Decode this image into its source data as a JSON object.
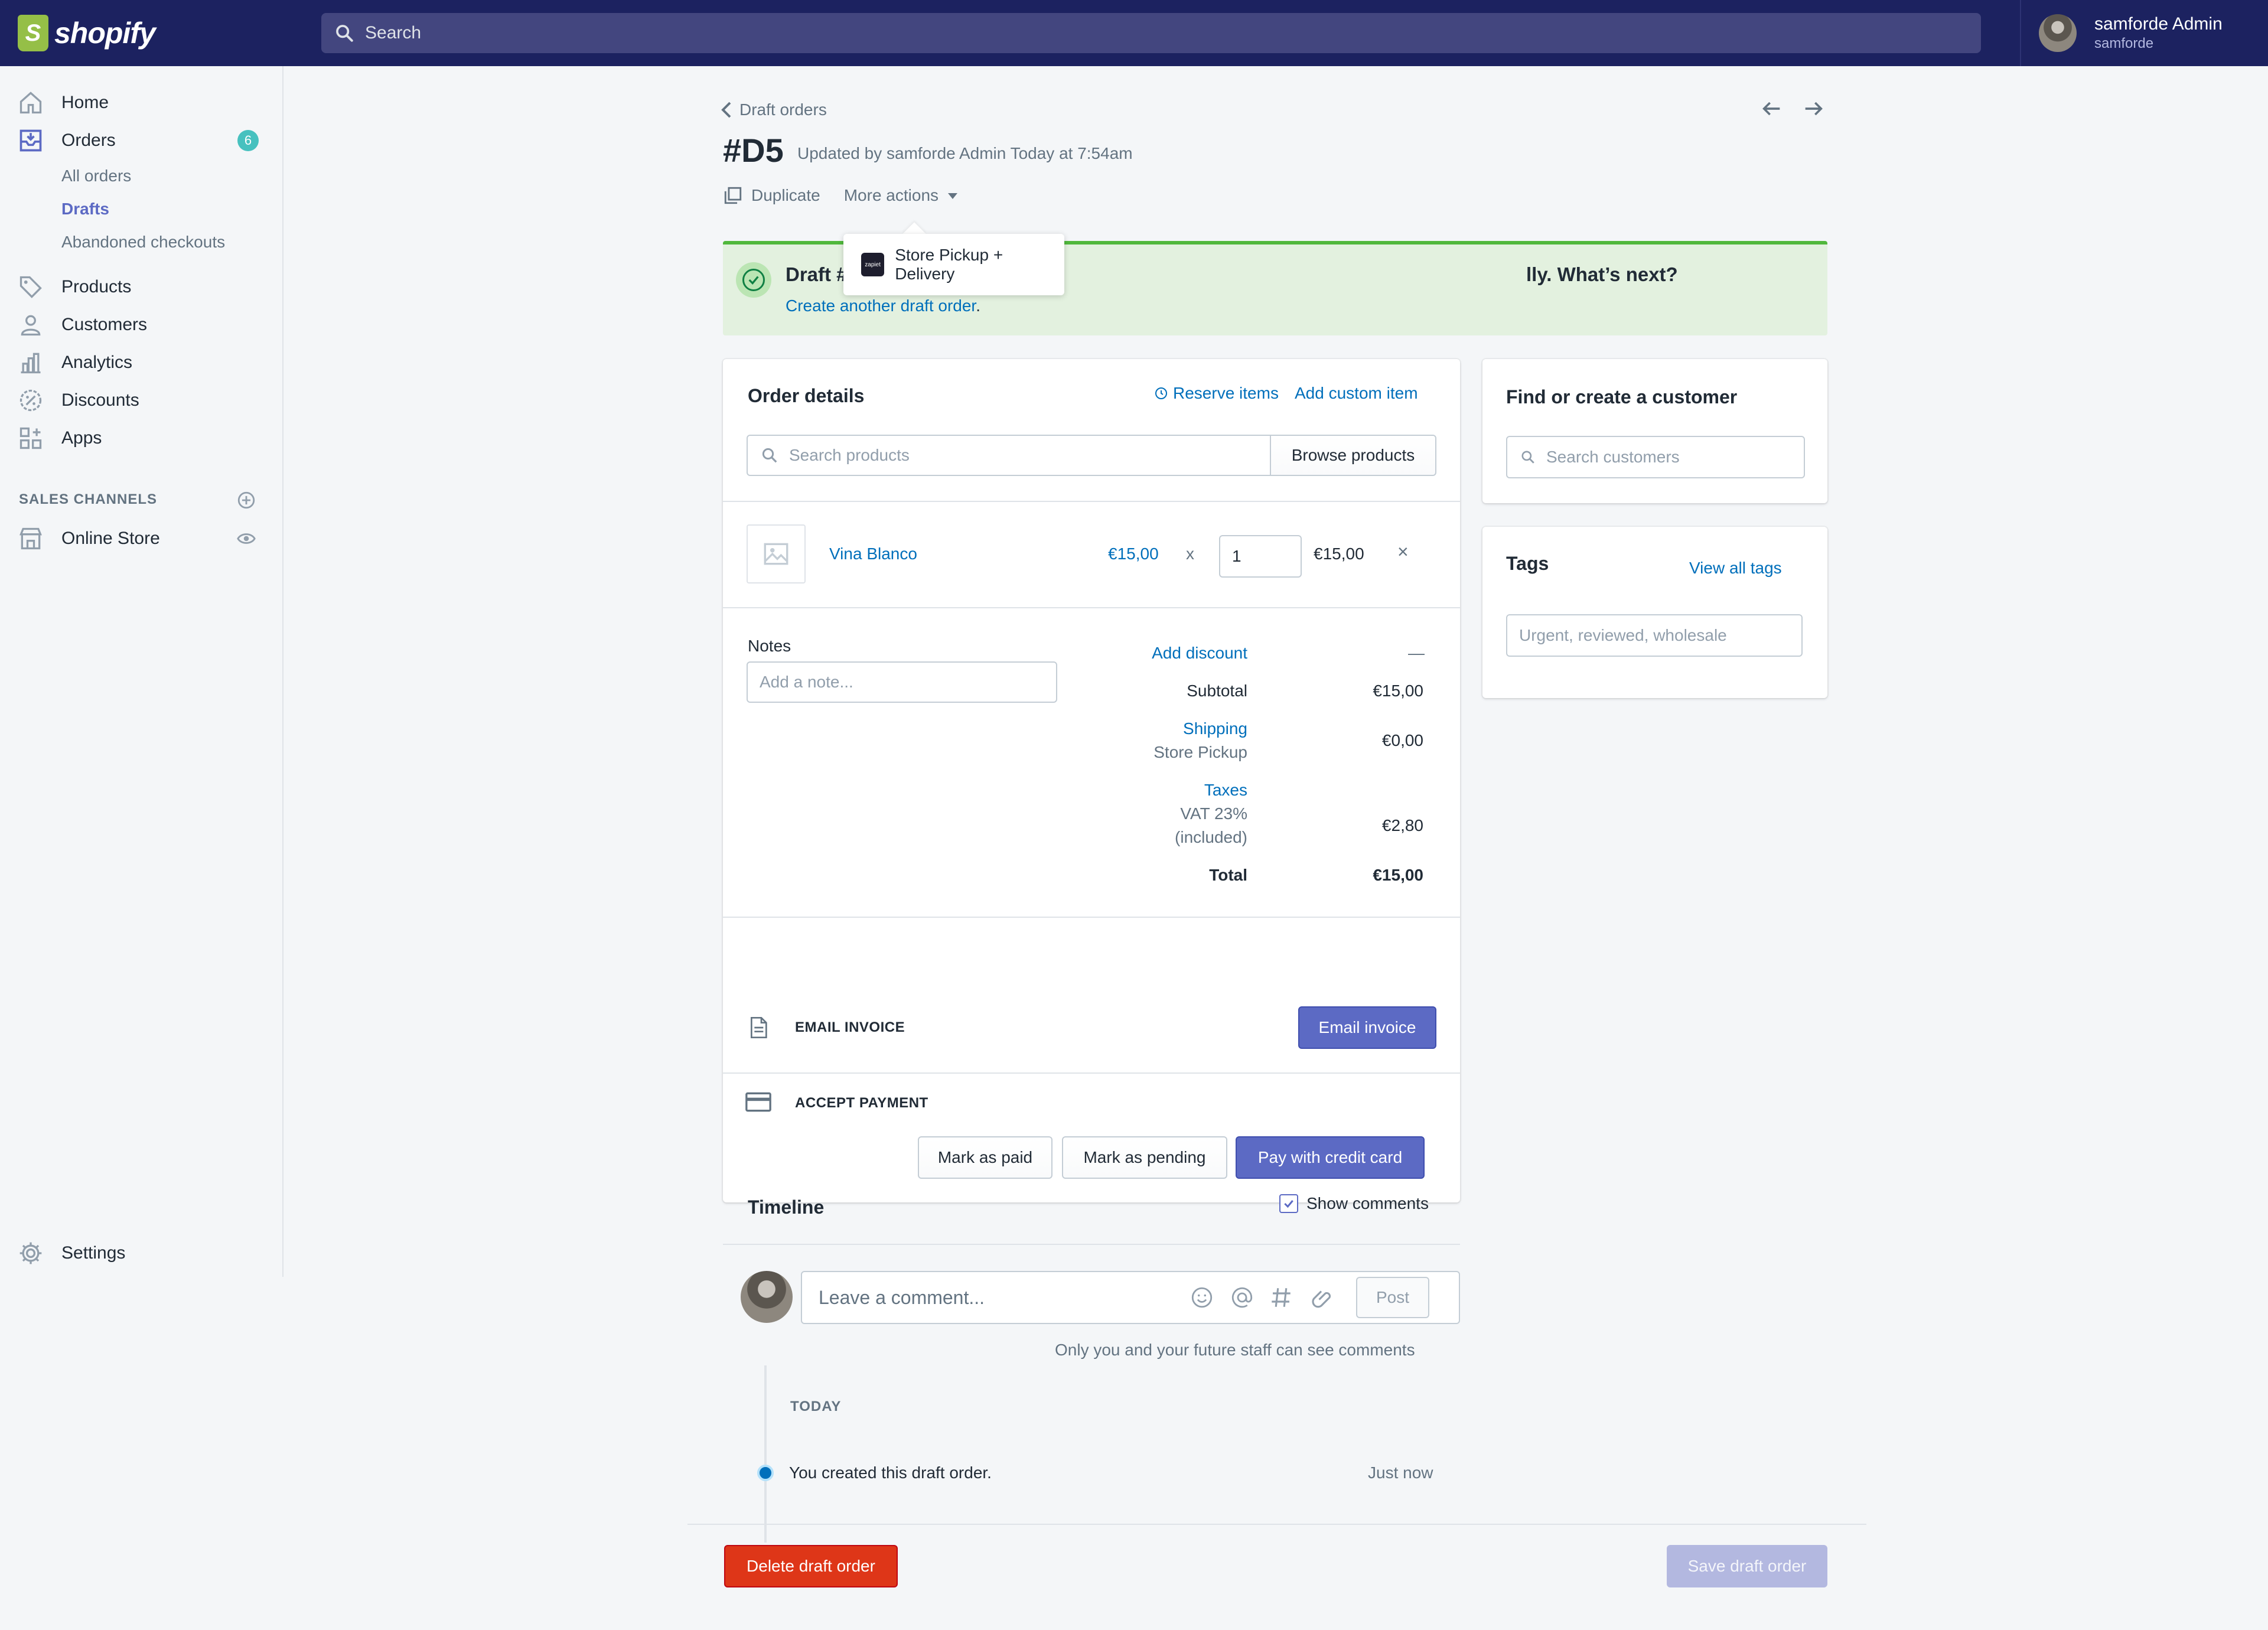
{
  "app": {
    "logo_text": "shopify",
    "logo_letter": "S"
  },
  "topbar": {
    "search_placeholder": "Search",
    "user_name": "samforde Admin",
    "user_store": "samforde"
  },
  "sidebar": {
    "items": [
      {
        "label": "Home",
        "icon": "home-icon"
      },
      {
        "label": "Orders",
        "icon": "orders-icon",
        "badge": "6"
      },
      {
        "label": "Products",
        "icon": "tag-icon"
      },
      {
        "label": "Customers",
        "icon": "person-icon"
      },
      {
        "label": "Analytics",
        "icon": "bar-chart-icon"
      },
      {
        "label": "Discounts",
        "icon": "discount-icon"
      },
      {
        "label": "Apps",
        "icon": "apps-icon"
      }
    ],
    "order_subitems": [
      "All orders",
      "Drafts",
      "Abandoned checkouts"
    ],
    "sales_channels_title": "SALES CHANNELS",
    "online_store": "Online Store",
    "settings": "Settings"
  },
  "page": {
    "back_label": "Draft orders",
    "title": "#D5",
    "subtitle": "Updated by samforde Admin Today at 7:54am",
    "duplicate": "Duplicate",
    "more_actions": "More actions"
  },
  "popover": {
    "item": "Store Pickup + Delivery",
    "app_icon_text": "zapiet"
  },
  "banner": {
    "title_start": "Draft #",
    "title_end": "lly. What’s next?",
    "link": "Create another draft order",
    "link_suffix": "."
  },
  "order": {
    "title": "Order details",
    "reserve_items": "Reserve items",
    "add_custom_item": "Add custom item",
    "search_placeholder": "Search products",
    "browse": "Browse products",
    "line_item": {
      "name": "Vina Blanco",
      "price": "€15,00",
      "times": "x",
      "qty": "1",
      "total": "€15,00",
      "remove": "×"
    },
    "notes_label": "Notes",
    "notes_placeholder": "Add a note...",
    "add_discount": "Add discount",
    "discount_value": "—",
    "subtotal_label": "Subtotal",
    "subtotal": "€15,00",
    "shipping_label": "Shipping",
    "shipping_method": "Store Pickup",
    "shipping": "€0,00",
    "taxes_label": "Taxes",
    "tax_rate": "VAT 23%",
    "tax_included": "(included)",
    "taxes": "€2,80",
    "total_label": "Total",
    "total": "€15,00",
    "email_invoice_label": "EMAIL INVOICE",
    "email_invoice_btn": "Email invoice",
    "accept_payment_label": "ACCEPT PAYMENT",
    "mark_paid": "Mark as paid",
    "mark_pending": "Mark as pending",
    "pay_card": "Pay with credit card"
  },
  "customer": {
    "title": "Find or create a customer",
    "search_placeholder": "Search customers"
  },
  "tags": {
    "title": "Tags",
    "view_all": "View all tags",
    "placeholder": "Urgent, reviewed, wholesale"
  },
  "timeline": {
    "title": "Timeline",
    "show_comments": "Show comments",
    "comment_placeholder": "Leave a comment...",
    "post": "Post",
    "privacy_note": "Only you and your future staff can see comments",
    "day": "TODAY",
    "event": "You created this draft order.",
    "event_time": "Just now"
  },
  "footer": {
    "delete": "Delete draft order",
    "save": "Save draft order"
  },
  "colors": {
    "topbar": "#1c2260",
    "primary": "#5c6ac4",
    "link": "#006fbb",
    "success": "#50b83c",
    "danger": "#de3618"
  }
}
